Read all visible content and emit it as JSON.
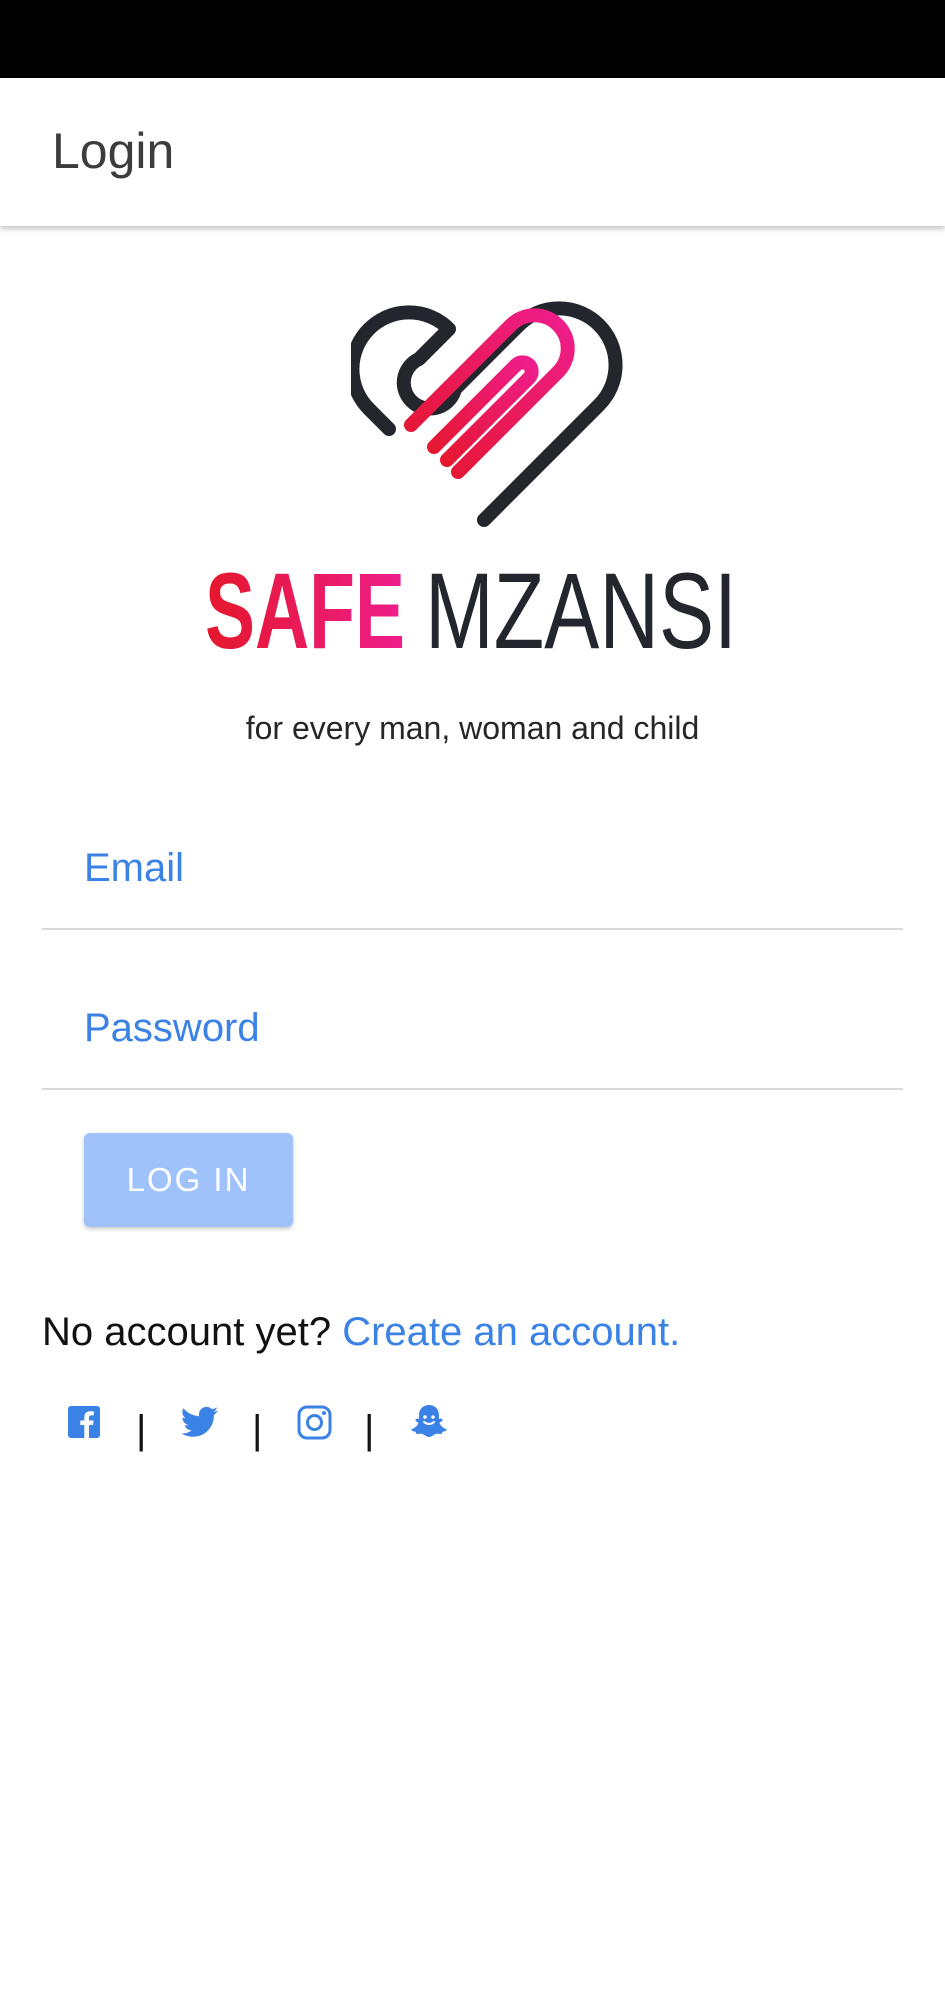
{
  "app_bar": {
    "title": "Login"
  },
  "logo": {
    "text_red": "SAFE",
    "text_dark": "MZANSI",
    "colors": {
      "red": "#e5172b",
      "magenta": "#ee1d8c",
      "dark": "#24262e"
    }
  },
  "tagline": "for every man, woman and child",
  "form": {
    "email_placeholder": "Email",
    "password_placeholder": "Password",
    "login_label": "LOG IN"
  },
  "signup": {
    "prompt": "No account yet?",
    "link": "Create an account."
  },
  "social": {
    "separator": "|",
    "icons": [
      "facebook-icon",
      "twitter-icon",
      "instagram-icon",
      "snapchat-icon"
    ]
  },
  "colors": {
    "accent": "#3b82e6",
    "button_disabled": "#9fc2fb"
  }
}
